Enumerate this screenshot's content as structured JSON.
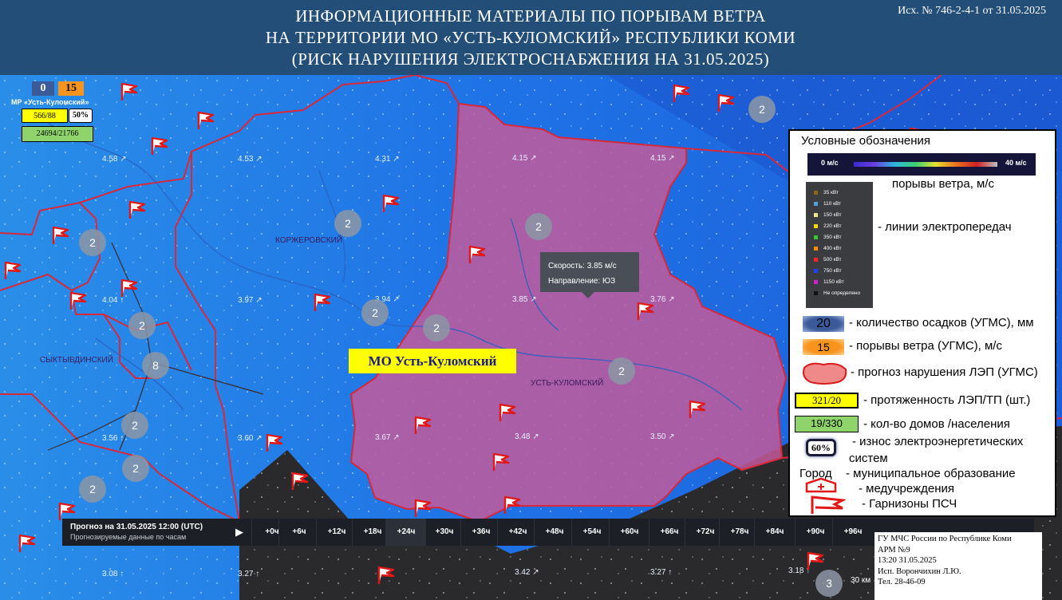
{
  "header": {
    "title_line1": "ИНФОРМАЦИОННЫЕ МАТЕРИАЛЫ ПО ПОРЫВАМ ВЕТРА",
    "title_line2": "НА ТЕРРИТОРИИ МО «УСТЬ-КУЛОМСКИЙ» РЕСПУБЛИКИ КОМИ",
    "title_line3": "(РИСК НАРУШЕНИЯ ЭЛЕКТРОСНАБЖЕНИЯ НА 31.05.2025)",
    "doc_ref": "Исх. № 746-2-4-1 от 31.05.2025"
  },
  "district_panel": {
    "precip": "0",
    "gusts": "15",
    "name": "МР «Усть-Куломский»",
    "lines": "566/88",
    "wear": "50%",
    "houses": "24694/21766"
  },
  "places": {
    "korzhersky": "КОРЖЕРОВСКИЙ",
    "syktyvdinsky": "СЫКТЫВДИНСКИЙ",
    "ust_kulomsky": "УСТЬ-КУЛОМСКИЙ"
  },
  "wind_values": [
    "4.58 ↗",
    "4.53 ↗",
    "4.31 ↗",
    "4.15 ↗",
    "4.15 ↗",
    "4.04 ↑",
    "3.97 ↗",
    "3.94 ↗",
    "3.85 ↗",
    "3.76 ↗",
    "3.56 ↑",
    "3.60 ↗",
    "3.67 ↗",
    "3.48 ↗",
    "3.50 ↗",
    "3.08 ↑",
    "3.27 ↑",
    "3.42 ↗",
    "3.27 ↑",
    "3.18 ↑"
  ],
  "clusters": [
    "2",
    "2",
    "2",
    "2",
    "2",
    "2",
    "2",
    "8",
    "2",
    "2",
    "2",
    "2",
    "3"
  ],
  "tooltip": {
    "speed": "Скорость: 3.85 м/с",
    "direction": "Направление: ЮЗ"
  },
  "mo_label": "МО Усть-Куломский",
  "timeline": {
    "title": "Прогноз на 31.05.2025 12:00 (UTC)",
    "subtitle": "Прогнозируемые данные по часам",
    "play_icon": "▶",
    "steps": [
      "+0ч",
      "+6ч",
      "+12ч",
      "+18ч",
      "+24ч",
      "+30ч",
      "+36ч",
      "+42ч",
      "+48ч",
      "+54ч",
      "+60ч",
      "+66ч",
      "+72ч",
      "+78ч",
      "+84ч",
      "+90ч",
      "+96ч"
    ]
  },
  "scale_label": "30 км",
  "infobox": {
    "line1": "ГУ МЧС России по Республике Коми",
    "line2": "АРМ №9",
    "line3": "13:20  31.05.2025",
    "line4": "Исп. Ворончихин Л.Ю.",
    "line5": "Тел. 28-46-09"
  },
  "legend": {
    "title": "Условные обозначения",
    "scale_min": "0 м/с",
    "scale_max": "40 м/с",
    "gusts_label": "порывы ветра, м/с",
    "line_classes": [
      {
        "label": "35 кВт",
        "color": "#8b6914"
      },
      {
        "label": "110 кВт",
        "color": "#4aa3df"
      },
      {
        "label": "150 кВт",
        "color": "#f0e68c"
      },
      {
        "label": "220 кВт",
        "color": "#ffd700"
      },
      {
        "label": "350 кВт",
        "color": "#32cd32"
      },
      {
        "label": "400 кВт",
        "color": "#ff8c00"
      },
      {
        "label": "500 кВт",
        "color": "#ff2020"
      },
      {
        "label": "750 кВт",
        "color": "#1e40ff"
      },
      {
        "label": "1150 кВт",
        "color": "#d020d0"
      },
      {
        "label": "Не определено",
        "color": "#111111"
      }
    ],
    "lines_label": "- линии электропередач",
    "precip_badge": "20",
    "precip_label": "- количество осадков (УГМС), мм",
    "gust_badge": "15",
    "gust_label": "- порывы ветра (УГМС), м/с",
    "risk_label": "- прогноз нарушения ЛЭП (УГМС)",
    "lines_badge": "321/20",
    "lines_len_label": "- протяженность ЛЭП/ТП (шт.)",
    "houses_badge": "19/330",
    "houses_label": "- кол-во домов /населения",
    "wear_badge": "60%",
    "wear_label_1": "- износ электроэнергетических",
    "wear_label_2": "систем",
    "city_word": "Город",
    "municipal_label": "- муниципальное образование",
    "med_label": "- медучреждения",
    "fire_label": "- Гарнизоны ПСЧ"
  },
  "colors": {
    "header_bg": "#234e78",
    "map_blue": "#1f6de0",
    "risk_fill": "#c25a9a",
    "boundary": "#d8283a",
    "label_yellow": "#ffff00"
  }
}
